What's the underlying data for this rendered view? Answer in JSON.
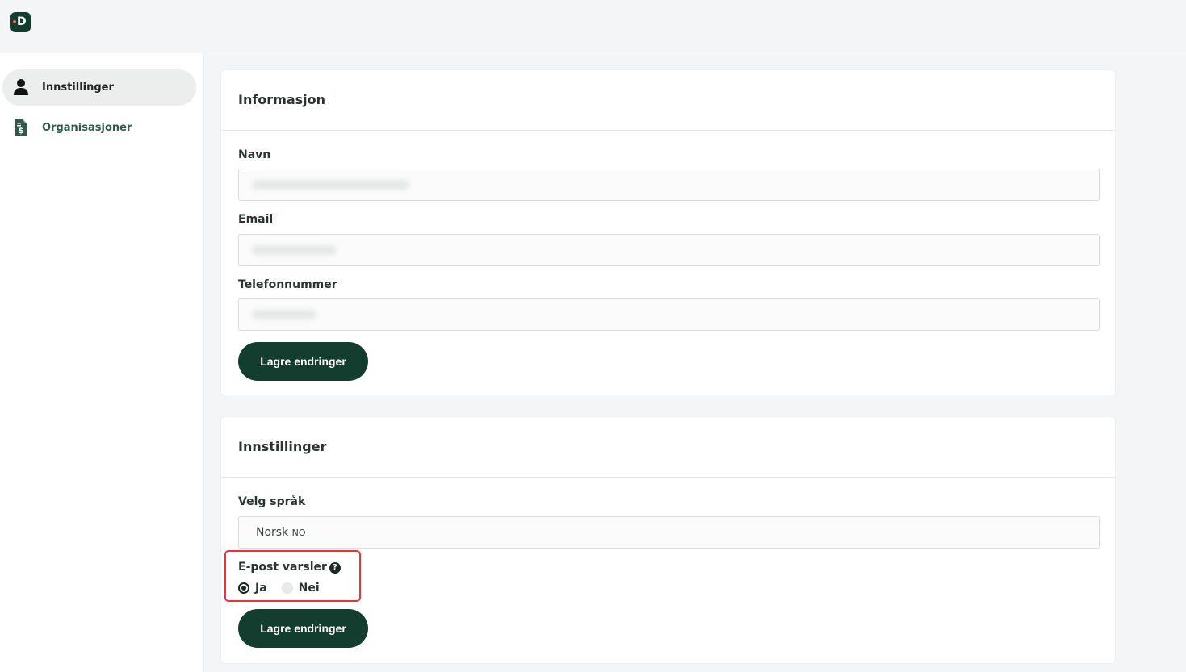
{
  "app": {
    "logo_letter": "D",
    "brand_color": "#123d2f",
    "accent_dot_color": "#e8654b"
  },
  "sidebar": {
    "items": [
      {
        "label": "Innstillinger",
        "icon": "user-icon",
        "active": true
      },
      {
        "label": "Organisasjoner",
        "icon": "document-dollar-icon",
        "active": false
      }
    ]
  },
  "information": {
    "title": "Informasjon",
    "fields": [
      {
        "label": "Navn",
        "value": ""
      },
      {
        "label": "Email",
        "value": ""
      },
      {
        "label": "Telefonnummer",
        "value": ""
      }
    ],
    "save_label": "Lagre endringer"
  },
  "settings": {
    "title": "Innstillinger",
    "language_label": "Velg språk",
    "language_value": "Norsk",
    "language_code": "NO",
    "email_alerts_label": "E-post varsler",
    "help_icon": "question-circle-icon",
    "options": [
      {
        "label": "Ja",
        "selected": true
      },
      {
        "label": "Nei",
        "selected": false
      }
    ],
    "save_label": "Lagre endringer"
  }
}
